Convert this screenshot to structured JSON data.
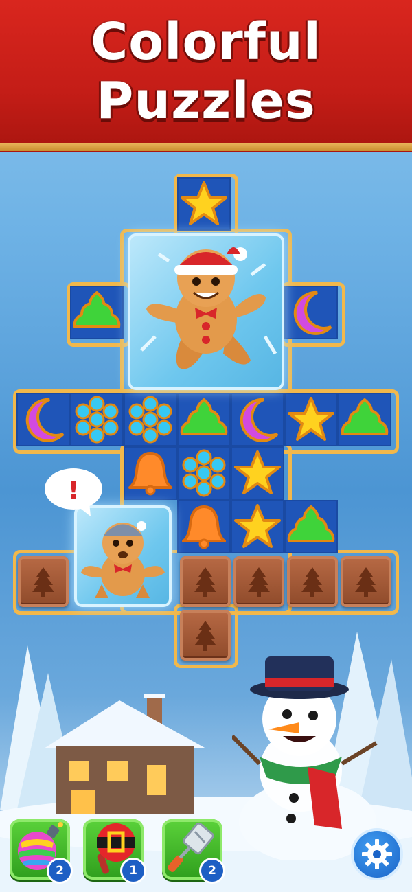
{
  "banner": {
    "line1": "Colorful",
    "line2": "Puzzles"
  },
  "colors": {
    "banner_red": "#c41d17",
    "banner_gold": "#f2b84b",
    "slot_blue": "#1f55b8",
    "booster_green": "#3fb42a",
    "count_blue": "#1d5fc4"
  },
  "board": {
    "rows": [
      [
        "empty",
        "empty",
        "empty",
        "star",
        "empty",
        "empty",
        "empty"
      ],
      [
        "empty",
        "empty",
        "frozen_gingerbread",
        "frozen_gingerbread",
        "frozen_gingerbread",
        "empty",
        "empty"
      ],
      [
        "empty",
        "tree",
        "frozen_gingerbread",
        "frozen_gingerbread",
        "frozen_gingerbread",
        "moon",
        "empty"
      ],
      [
        "empty",
        "empty",
        "frozen_gingerbread",
        "frozen_gingerbread",
        "frozen_gingerbread",
        "empty",
        "empty"
      ],
      [
        "moon",
        "snowflake",
        "snowflake",
        "tree",
        "moon",
        "star",
        "tree"
      ],
      [
        "empty",
        "empty",
        "bell",
        "snowflake",
        "star",
        "empty",
        "empty"
      ],
      [
        "empty",
        "iced_gingerbread",
        "iced_gingerbread",
        "bell",
        "star",
        "tree",
        "empty"
      ],
      [
        "chocolate",
        "iced_gingerbread",
        "iced_gingerbread",
        "chocolate",
        "chocolate",
        "chocolate",
        "chocolate"
      ],
      [
        "empty",
        "empty",
        "empty",
        "chocolate",
        "empty",
        "empty",
        "empty"
      ]
    ],
    "alert_bubble": "!"
  },
  "boosters": [
    {
      "name": "rainbow-bomb",
      "icon": "rainbow-ornament-bomb-icon",
      "count": "2"
    },
    {
      "name": "santa-hammer",
      "icon": "santa-belt-hammer-icon",
      "count": "1"
    },
    {
      "name": "spatula",
      "icon": "spatula-icon",
      "count": "2"
    }
  ],
  "settings": {
    "icon": "gear-icon"
  }
}
